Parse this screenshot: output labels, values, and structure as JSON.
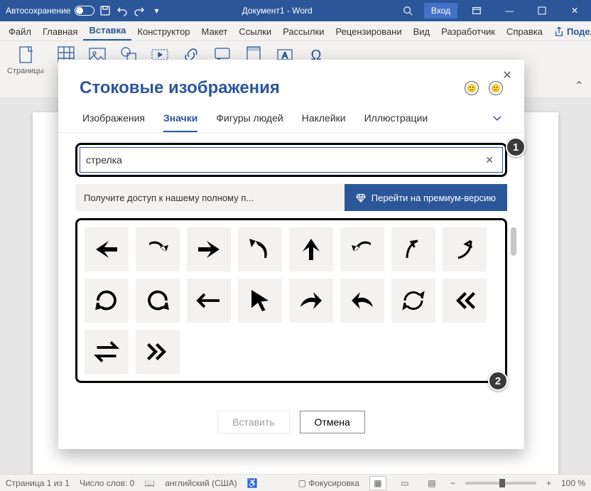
{
  "titlebar": {
    "autosave": "Автосохранение",
    "doc_title": "Документ1 - Word",
    "login": "Вход"
  },
  "ribbon": {
    "tabs": [
      "Файл",
      "Главная",
      "Вставка",
      "Конструктор",
      "Макет",
      "Ссылки",
      "Рассылки",
      "Рецензировани",
      "Вид",
      "Разработчик",
      "Справка"
    ],
    "active_tab": "Вставка",
    "share": "Поделиться",
    "group_pages": "Страницы"
  },
  "dialog": {
    "title": "Стоковые изображения",
    "tabs": [
      "Изображения",
      "Значки",
      "Фигуры людей",
      "Наклейки",
      "Иллюстрации"
    ],
    "active_tab": "Значки",
    "search_value": "стрелка",
    "premium_msg": "Получите доступ к нашему полному п...",
    "premium_btn": "Перейти на премиум-версию",
    "insert": "Вставить",
    "cancel": "Отмена",
    "icons": [
      "arrow-left-solid",
      "arrow-curve-down",
      "arrow-right-solid",
      "arrow-curve-up-left",
      "arrow-up-solid",
      "arrow-curve-down-left",
      "arrow-curve-up-thin",
      "arrow-curve-up-right",
      "rotate-cw",
      "rotate-ccw",
      "arrow-left-thin",
      "cursor-solid",
      "arrow-redo",
      "arrow-undo",
      "refresh-circle",
      "chevrons-left",
      "arrows-swap-horizontal",
      "chevrons-right"
    ]
  },
  "status": {
    "page": "Страница 1 из 1",
    "words": "Число слов: 0",
    "lang": "английский (США)",
    "focus": "Фокусировка",
    "zoom": "100 %"
  },
  "callouts": {
    "one": "1",
    "two": "2"
  }
}
